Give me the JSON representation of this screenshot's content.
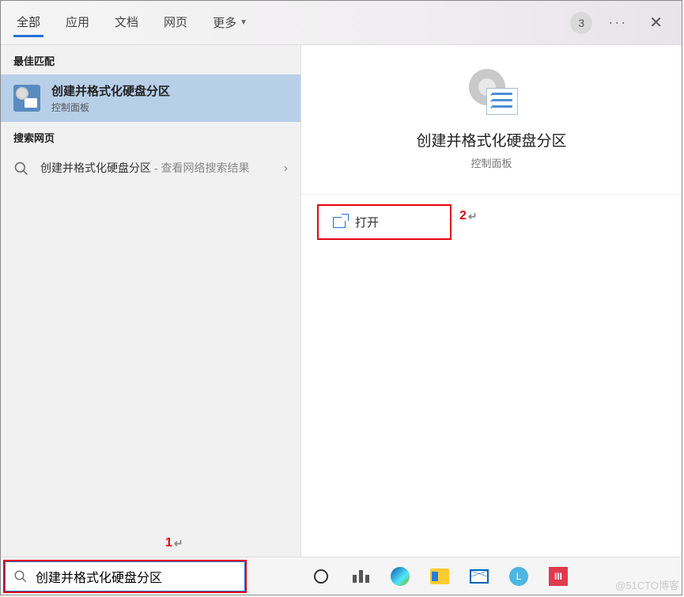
{
  "titlebar": {
    "tabs": [
      "全部",
      "应用",
      "文档",
      "网页",
      "更多"
    ],
    "badge": "3"
  },
  "left": {
    "best_match_header": "最佳匹配",
    "best_match": {
      "title": "创建并格式化硬盘分区",
      "subtitle": "控制面板"
    },
    "web_header": "搜索网页",
    "web_item": {
      "prefix": "创建并格式化硬盘分区",
      "suffix": " - 查看网络搜索结果"
    }
  },
  "right": {
    "title": "创建并格式化硬盘分区",
    "subtitle": "控制面板",
    "open_label": "打开"
  },
  "annotations": {
    "one": "1",
    "two": "2",
    "return": "↵"
  },
  "search": {
    "value": "创建并格式化硬盘分区"
  },
  "taskbar": {
    "l_label": "L",
    "todo_label": "III"
  },
  "watermark": "@51CTO博客"
}
